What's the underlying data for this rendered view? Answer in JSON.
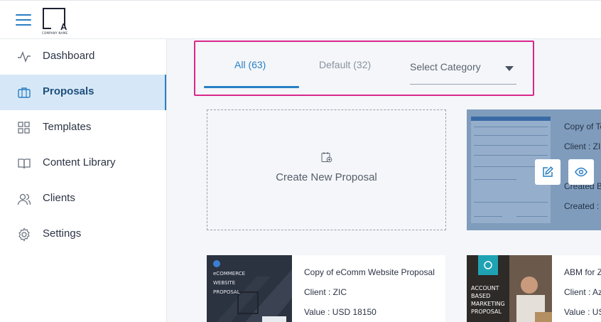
{
  "header": {
    "logo_letter": "A",
    "logo_subtext": "COMPANY NAME"
  },
  "sidebar": {
    "items": [
      {
        "label": "Dashboard",
        "icon": "activity-icon",
        "active": false
      },
      {
        "label": "Proposals",
        "icon": "briefcase-icon",
        "active": true
      },
      {
        "label": "Templates",
        "icon": "grid-icon",
        "active": false
      },
      {
        "label": "Content Library",
        "icon": "book-icon",
        "active": false
      },
      {
        "label": "Clients",
        "icon": "users-icon",
        "active": false
      },
      {
        "label": "Settings",
        "icon": "gear-icon",
        "active": false
      }
    ]
  },
  "tabs": [
    {
      "label": "All (63)",
      "active": true
    },
    {
      "label": "Default (32)",
      "active": false
    }
  ],
  "category_select": {
    "label": "Select Category"
  },
  "create_card": {
    "label": "Create New Proposal"
  },
  "template_card": {
    "title": "Copy of Te",
    "client": "Client : ZI",
    "created_partial": "Created B",
    "created": "Created : I"
  },
  "proposals": [
    {
      "thumb_lines": [
        "eCOMMERCE",
        "WEBSITE",
        "PROPOSAL"
      ],
      "title": "Copy of eComm Website Proposal",
      "client": "Client : ZIC",
      "value": "Value : USD 18150"
    },
    {
      "thumb_lines": [
        "ACCOUNT",
        "BASED",
        "MARKETING",
        "PROPOSAL"
      ],
      "title": "ABM for Z",
      "client": "Client : Az",
      "value": "Value : USD"
    }
  ],
  "colors": {
    "accent": "#2a7fc4",
    "highlight_border": "#d9288b",
    "active_nav_bg": "#d6e8f7"
  }
}
